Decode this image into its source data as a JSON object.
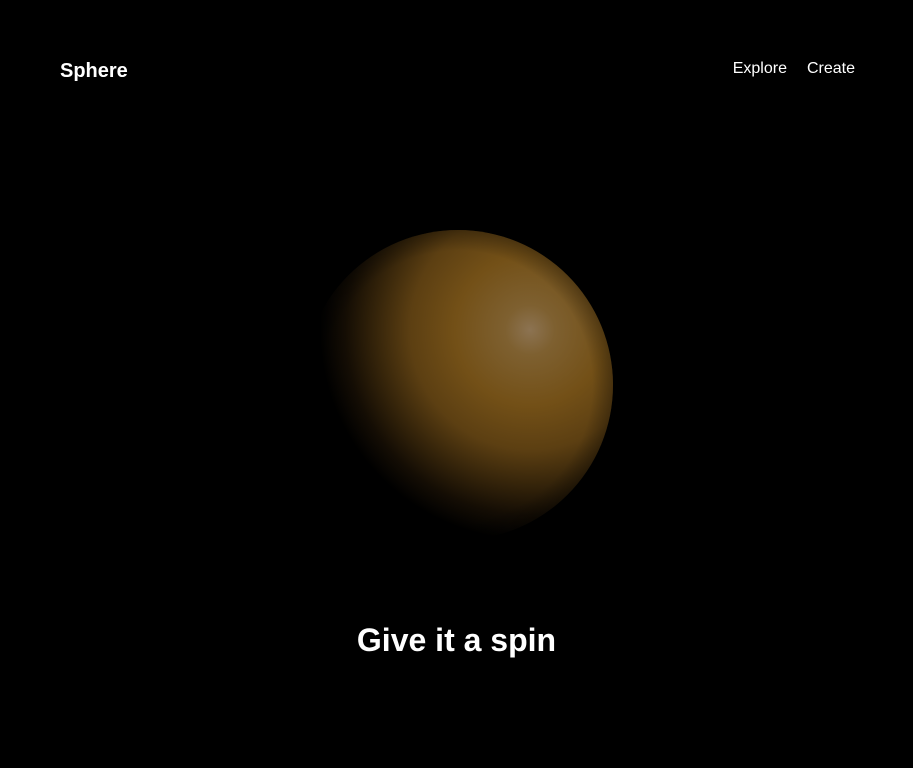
{
  "header": {
    "logo": "Sphere",
    "nav": [
      {
        "label": "Explore"
      },
      {
        "label": "Create"
      }
    ]
  },
  "hero": {
    "tagline": "Give it a spin"
  },
  "sphere": {
    "base_color": "#7a5418",
    "highlight_color": "#8c7352",
    "background_color": "#000000",
    "icon": "lit-sphere"
  }
}
